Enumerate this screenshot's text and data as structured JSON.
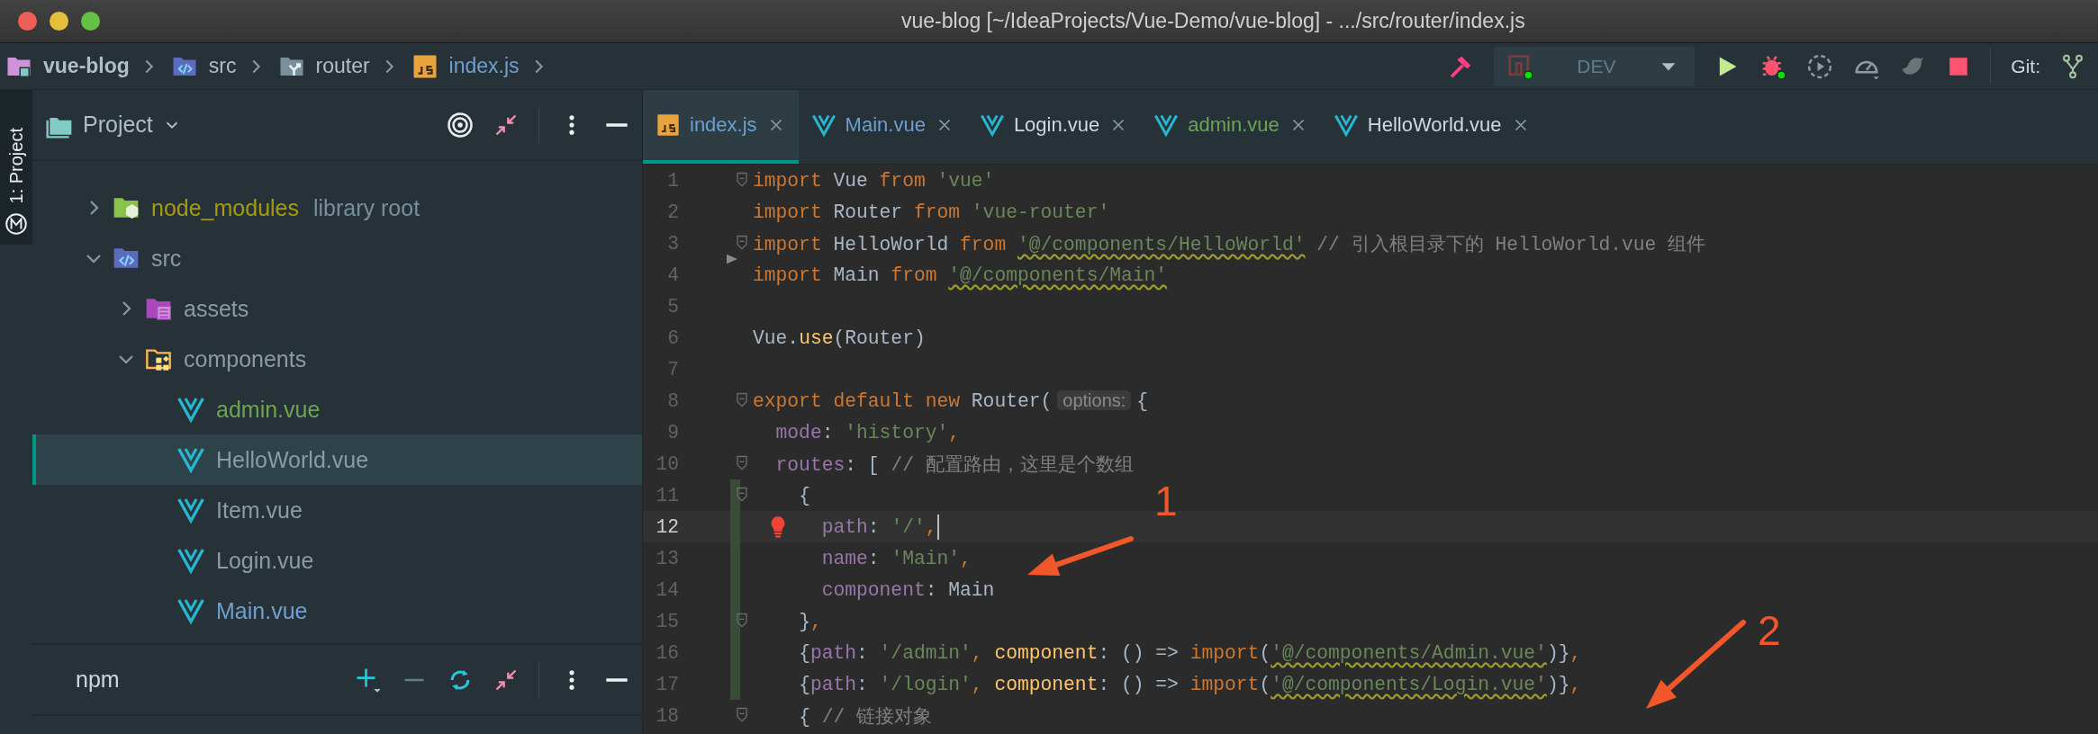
{
  "window": {
    "title": "vue-blog [~/IdeaProjects/Vue-Demo/vue-blog] - .../src/router/index.js"
  },
  "breadcrumbs": [
    {
      "label": "vue-blog",
      "kind": "project",
      "color": "#b0bec5"
    },
    {
      "label": "src",
      "kind": "source",
      "color": "#b0bec5"
    },
    {
      "label": "router",
      "kind": "router",
      "color": "#b0bec5"
    },
    {
      "label": "index.js",
      "kind": "js",
      "color": "#6e9fd0"
    }
  ],
  "run_config": {
    "label": "DEV"
  },
  "git": {
    "label": "Git:"
  },
  "tool_strip": {
    "label": "1: Project"
  },
  "project_panel": {
    "title": "Project",
    "tree": [
      {
        "label": "node_modules",
        "note": "library root",
        "kind": "library-folder",
        "color": "#a59b10",
        "expanded": false,
        "selected": false
      },
      {
        "label": "src",
        "kind": "source-folder",
        "color": "#8a9ba3",
        "expanded": true,
        "selected": false,
        "children": [
          {
            "label": "assets",
            "kind": "resource-folder",
            "color": "#8a9ba3",
            "expanded": false,
            "selected": false
          },
          {
            "label": "components",
            "kind": "component-folder",
            "color": "#8a9ba3",
            "expanded": true,
            "selected": false,
            "children": [
              {
                "label": "admin.vue",
                "kind": "vue",
                "color": "#6da453",
                "selected": false
              },
              {
                "label": "HelloWorld.vue",
                "kind": "vue",
                "color": "#8a9ba3",
                "selected": true
              },
              {
                "label": "Item.vue",
                "kind": "vue",
                "color": "#8a9ba3",
                "selected": false
              },
              {
                "label": "Login.vue",
                "kind": "vue",
                "color": "#8a9ba3",
                "selected": false
              },
              {
                "label": "Main.vue",
                "kind": "vue",
                "color": "#6e9fd0",
                "selected": false
              }
            ]
          }
        ]
      }
    ]
  },
  "npm_panel": {
    "title": "npm"
  },
  "editor": {
    "tabs": [
      {
        "label": "index.js",
        "kind": "js",
        "color": "#6e9fd0",
        "selected": true
      },
      {
        "label": "Main.vue",
        "kind": "vue",
        "color": "#6e9fd0",
        "selected": false
      },
      {
        "label": "Login.vue",
        "kind": "vue",
        "color": "#cfd8dc",
        "selected": false
      },
      {
        "label": "admin.vue",
        "kind": "vue",
        "color": "#6da453",
        "selected": false
      },
      {
        "label": "HelloWorld.vue",
        "kind": "vue",
        "color": "#cfd8dc",
        "selected": false
      }
    ],
    "lines": [
      {
        "number": "1",
        "fold": true,
        "changed": false,
        "current": false,
        "bulb": false,
        "gutter_arrow": false,
        "tokens": [
          {
            "kind": "keyword",
            "text": "import"
          },
          {
            "kind": "plain",
            "text": " Vue "
          },
          {
            "kind": "keyword",
            "text": "from"
          },
          {
            "kind": "string",
            "text": " 'vue'"
          }
        ]
      },
      {
        "number": "2",
        "fold": false,
        "changed": false,
        "current": false,
        "bulb": false,
        "gutter_arrow": false,
        "tokens": [
          {
            "kind": "keyword",
            "text": "import"
          },
          {
            "kind": "plain",
            "text": " Router "
          },
          {
            "kind": "keyword",
            "text": "from"
          },
          {
            "kind": "string",
            "text": " 'vue-router'"
          }
        ]
      },
      {
        "number": "3",
        "fold": true,
        "changed": false,
        "current": false,
        "bulb": false,
        "gutter_arrow": false,
        "tokens": [
          {
            "kind": "keyword",
            "text": "import"
          },
          {
            "kind": "plain",
            "text": " HelloWorld "
          },
          {
            "kind": "keyword",
            "text": "from "
          },
          {
            "kind": "unresolved",
            "text": "'@/components/HelloWorld'"
          },
          {
            "kind": "comment",
            "text": " // 引入根目录下的 HelloWorld.vue 组件"
          }
        ]
      },
      {
        "number": "4",
        "fold": false,
        "changed": false,
        "current": false,
        "bulb": false,
        "gutter_arrow": true,
        "tokens": [
          {
            "kind": "keyword",
            "text": "import"
          },
          {
            "kind": "plain",
            "text": " Main "
          },
          {
            "kind": "keyword",
            "text": "from "
          },
          {
            "kind": "unresolved",
            "text": "'@/components/Main'"
          }
        ]
      },
      {
        "number": "5",
        "fold": false,
        "changed": false,
        "current": false,
        "bulb": false,
        "gutter_arrow": false
      },
      {
        "number": "6",
        "fold": false,
        "changed": false,
        "current": false,
        "bulb": false,
        "gutter_arrow": false,
        "tokens": [
          {
            "kind": "plain",
            "text": "Vue."
          },
          {
            "kind": "function",
            "text": "use"
          },
          {
            "kind": "plain",
            "text": "(Router)"
          }
        ]
      },
      {
        "number": "7",
        "fold": false,
        "changed": false,
        "current": false,
        "bulb": false,
        "gutter_arrow": false
      },
      {
        "number": "8",
        "fold": true,
        "changed": false,
        "current": false,
        "bulb": false,
        "gutter_arrow": false,
        "tokens": [
          {
            "kind": "keyword",
            "text": "export default new"
          },
          {
            "kind": "plain",
            "text": " Router("
          },
          {
            "kind": "hint",
            "text": "options:"
          },
          {
            "kind": "plain",
            "text": "{"
          }
        ]
      },
      {
        "number": "9",
        "fold": false,
        "changed": false,
        "current": false,
        "bulb": false,
        "gutter_arrow": false,
        "tokens": [
          {
            "kind": "property",
            "text": "  mode"
          },
          {
            "kind": "plain",
            "text": ": "
          },
          {
            "kind": "string",
            "text": "'history'"
          },
          {
            "kind": "keyword",
            "text": ","
          }
        ]
      },
      {
        "number": "10",
        "fold": true,
        "changed": false,
        "current": false,
        "bulb": false,
        "gutter_arrow": false,
        "tokens": [
          {
            "kind": "property",
            "text": "  routes"
          },
          {
            "kind": "plain",
            "text": ": [ "
          },
          {
            "kind": "comment",
            "text": "// 配置路由，这里是个数组"
          }
        ]
      },
      {
        "number": "11",
        "fold": true,
        "changed": true,
        "current": false,
        "bulb": false,
        "gutter_arrow": false,
        "tokens": [
          {
            "kind": "plain",
            "text": "    {"
          }
        ]
      },
      {
        "number": "12",
        "fold": false,
        "changed": true,
        "current": true,
        "bulb": true,
        "gutter_arrow": false,
        "tokens": [
          {
            "kind": "property",
            "text": "      path"
          },
          {
            "kind": "plain",
            "text": ": "
          },
          {
            "kind": "string",
            "text": "'/'"
          },
          {
            "kind": "keyword",
            "text": ","
          }
        ]
      },
      {
        "number": "13",
        "fold": false,
        "changed": true,
        "current": false,
        "bulb": false,
        "gutter_arrow": false,
        "tokens": [
          {
            "kind": "property",
            "text": "      name"
          },
          {
            "kind": "plain",
            "text": ": "
          },
          {
            "kind": "string",
            "text": "'Main'"
          },
          {
            "kind": "keyword",
            "text": ","
          }
        ]
      },
      {
        "number": "14",
        "fold": false,
        "changed": true,
        "current": false,
        "bulb": false,
        "gutter_arrow": false,
        "tokens": [
          {
            "kind": "property",
            "text": "      component"
          },
          {
            "kind": "plain",
            "text": ": Main"
          }
        ]
      },
      {
        "number": "15",
        "fold": true,
        "changed": true,
        "current": false,
        "bulb": false,
        "gutter_arrow": false,
        "tokens": [
          {
            "kind": "plain",
            "text": "    }"
          },
          {
            "kind": "keyword",
            "text": ","
          }
        ]
      },
      {
        "number": "16",
        "fold": false,
        "changed": true,
        "current": false,
        "bulb": false,
        "gutter_arrow": false,
        "tokens": [
          {
            "kind": "plain",
            "text": "    {"
          },
          {
            "kind": "property",
            "text": "path"
          },
          {
            "kind": "plain",
            "text": ": "
          },
          {
            "kind": "string",
            "text": "'/admin'"
          },
          {
            "kind": "keyword",
            "text": ","
          },
          {
            "kind": "function",
            "text": " component"
          },
          {
            "kind": "plain",
            "text": ": () => "
          },
          {
            "kind": "keyword",
            "text": "import"
          },
          {
            "kind": "plain",
            "text": "("
          },
          {
            "kind": "unresolved",
            "text": "'@/components/Admin.vue'"
          },
          {
            "kind": "plain",
            "text": ")}"
          },
          {
            "kind": "keyword",
            "text": ","
          }
        ]
      },
      {
        "number": "17",
        "fold": false,
        "changed": true,
        "current": false,
        "bulb": false,
        "gutter_arrow": false,
        "tokens": [
          {
            "kind": "plain",
            "text": "    {"
          },
          {
            "kind": "property",
            "text": "path"
          },
          {
            "kind": "plain",
            "text": ": "
          },
          {
            "kind": "string",
            "text": "'/login'"
          },
          {
            "kind": "keyword",
            "text": ","
          },
          {
            "kind": "function",
            "text": " component"
          },
          {
            "kind": "plain",
            "text": ": () => "
          },
          {
            "kind": "keyword",
            "text": "import"
          },
          {
            "kind": "plain",
            "text": "("
          },
          {
            "kind": "unresolved",
            "text": "'@/components/Login.vue'"
          },
          {
            "kind": "plain",
            "text": ")}"
          },
          {
            "kind": "keyword",
            "text": ","
          }
        ]
      },
      {
        "number": "18",
        "fold": true,
        "changed": false,
        "current": false,
        "bulb": false,
        "gutter_arrow": false,
        "tokens": [
          {
            "kind": "plain",
            "text": "    { "
          },
          {
            "kind": "comment",
            "text": "// 链接对象"
          }
        ]
      }
    ]
  },
  "annotations": [
    {
      "label": "1"
    },
    {
      "label": "2"
    }
  ]
}
